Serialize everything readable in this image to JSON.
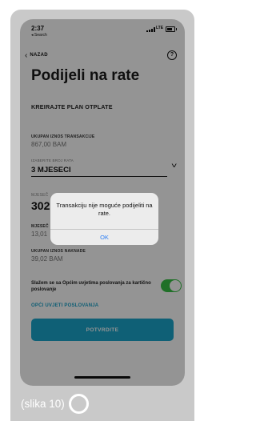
{
  "status_bar": {
    "time": "2:37",
    "back_app": "◂ Search",
    "network": "LTE"
  },
  "nav": {
    "back_label": "NAZAD",
    "help_symbol": "?"
  },
  "page": {
    "title": "Podijeli na rate",
    "section": "KREIRAJTE PLAN OTPLATE"
  },
  "transaction": {
    "label": "UKUPAN IZNOS TRANSAKCIJE",
    "value": "867,00 BAM"
  },
  "installments": {
    "label": "IZABERITE BROJ RATA",
    "value": "3 MJESECI"
  },
  "monthly": {
    "label": "MJESEČ",
    "value": "302"
  },
  "monthly2": {
    "label": "MJESEČ",
    "value": "13,01"
  },
  "fee": {
    "label": "UKUPAN IZNOS NAKNADE",
    "value": "39,02 BAM"
  },
  "terms": {
    "text": "Slažem se sa Općim uvjetima poslovanja za kartično poslovanje",
    "toggle_on": true,
    "link": "OPĆI UVJETI POSLOVANJA"
  },
  "confirm_label": "POTVRDITE",
  "alert": {
    "message": "Transakciju nije moguće podijeliti na rate.",
    "ok": "OK"
  },
  "caption": "(slika 10)",
  "colors": {
    "accent": "#1ba5cc",
    "toggle": "#38c145",
    "alert_button": "#2d7ef4"
  }
}
